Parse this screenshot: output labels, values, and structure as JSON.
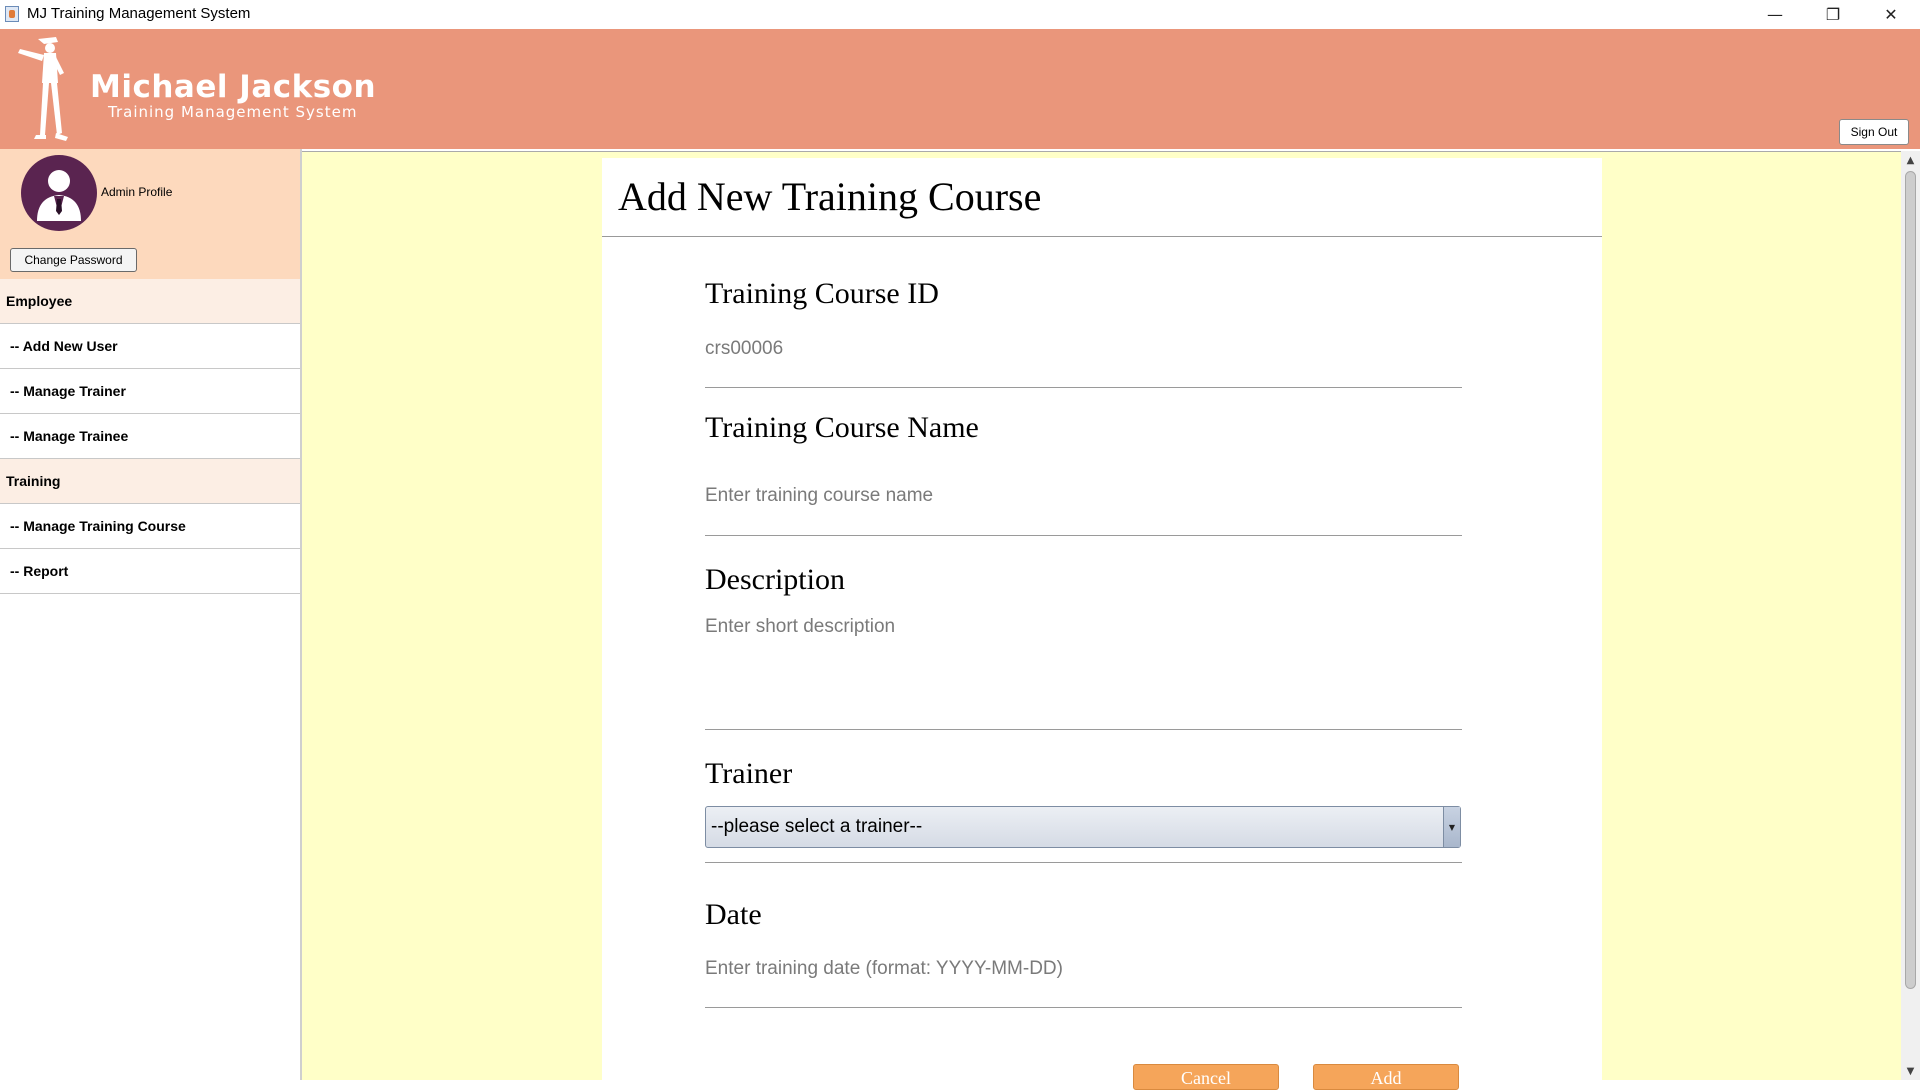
{
  "window": {
    "title": "MJ Training Management System",
    "minimize_icon": "minimize-icon",
    "maximize_icon": "restore-icon",
    "close_icon": "close-icon"
  },
  "header": {
    "brand_title": "Michael Jackson",
    "brand_subtitle": "Training Management System",
    "signout_label": "Sign Out",
    "background_color": "#ea967b"
  },
  "sidebar": {
    "profile_label": "Admin Profile",
    "change_password_label": "Change Password",
    "items": [
      {
        "label": "Employee",
        "kind": "section"
      },
      {
        "label": "-- Add New User",
        "kind": "link"
      },
      {
        "label": "-- Manage Trainer",
        "kind": "link"
      },
      {
        "label": "-- Manage Trainee",
        "kind": "link"
      },
      {
        "label": "Training",
        "kind": "section"
      },
      {
        "label": "-- Manage Training Course",
        "kind": "link"
      },
      {
        "label": "-- Report",
        "kind": "link"
      }
    ]
  },
  "form": {
    "title": "Add New Training Course",
    "course_id": {
      "label": "Training Course ID",
      "value": "crs00006"
    },
    "course_name": {
      "label": "Training Course Name",
      "placeholder": "Enter training course name"
    },
    "description": {
      "label": "Description",
      "placeholder": "Enter short description"
    },
    "trainer": {
      "label": "Trainer",
      "selected": "--please select a trainer--"
    },
    "date": {
      "label": "Date",
      "placeholder": "Enter training date (format: YYYY-MM-DD)"
    },
    "cancel_label": "Cancel",
    "add_label": "Add"
  },
  "colors": {
    "main_background": "#ffffc8",
    "profile_background": "#fdd9bd",
    "button_accent": "#f5a55a"
  }
}
